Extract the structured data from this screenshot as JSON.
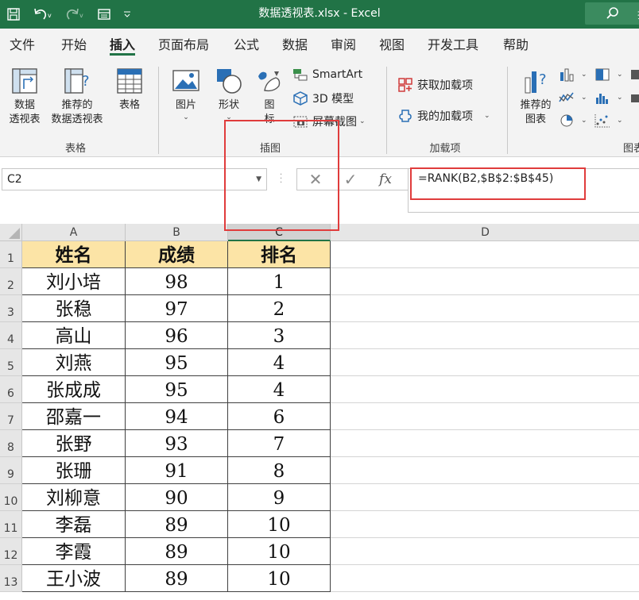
{
  "window": {
    "title": "数据透视表.xlsx  -  Excel",
    "search_label": "搜"
  },
  "ribbon_tabs": [
    "文件",
    "开始",
    "插入",
    "页面布局",
    "公式",
    "数据",
    "审阅",
    "视图",
    "开发工具",
    "帮助"
  ],
  "active_tab": "插入",
  "ribbon": {
    "tables_group": {
      "label": "表格",
      "pivot_table": [
        "数据",
        "透视表"
      ],
      "recommended_pivot": [
        "推荐的",
        "数据透视表"
      ],
      "table": "表格"
    },
    "illustrations_group": {
      "label": "插图",
      "pictures": "图片",
      "shapes": "形状",
      "icons": [
        "图",
        "标"
      ],
      "smartart": "SmartArt",
      "model3d": "3D 模型",
      "screenshot": "屏幕截图"
    },
    "addins_group": {
      "label": "加载项",
      "get_addins": "获取加载项",
      "my_addins": "我的加载项"
    },
    "charts_group": {
      "recommended_charts": [
        "推荐的",
        "图表"
      ],
      "label_partial": "图表"
    }
  },
  "formula_bar": {
    "name_box": "C2",
    "formula": "=RANK(B2,$B$2:$B$45)",
    "fx": "fx"
  },
  "sheet": {
    "columns": [
      "A",
      "B",
      "C",
      "D"
    ],
    "selected_column": "C",
    "row_numbers": [
      "1",
      "2",
      "3",
      "4",
      "5",
      "6",
      "7",
      "8",
      "9",
      "10",
      "11",
      "12",
      "13"
    ],
    "header_row": [
      "姓名",
      "成绩",
      "排名"
    ],
    "rows": [
      [
        "刘小培",
        "98",
        "1"
      ],
      [
        "张稳",
        "97",
        "2"
      ],
      [
        "高山",
        "96",
        "3"
      ],
      [
        "刘燕",
        "95",
        "4"
      ],
      [
        "张成成",
        "95",
        "4"
      ],
      [
        "邵嘉一",
        "94",
        "6"
      ],
      [
        "张野",
        "93",
        "7"
      ],
      [
        "张珊",
        "91",
        "8"
      ],
      [
        "刘柳意",
        "90",
        "9"
      ],
      [
        "李磊",
        "89",
        "10"
      ],
      [
        "李霞",
        "89",
        "10"
      ],
      [
        "王小波",
        "89",
        "10"
      ]
    ]
  },
  "colors": {
    "excel_green": "#217346",
    "header_fill": "#fce4a6",
    "highlight_red": "#e03c3c"
  }
}
